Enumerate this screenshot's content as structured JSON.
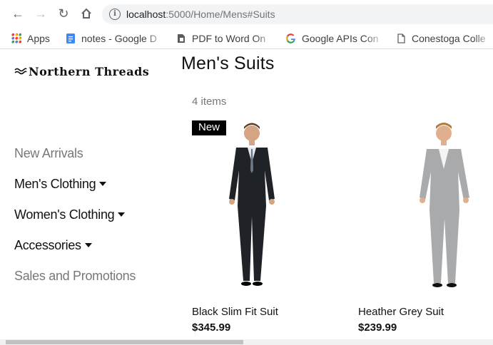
{
  "browser": {
    "url_host": "localhost",
    "url_rest": ":5000/Home/Mens#Suits",
    "bookmarks": [
      {
        "label": "Apps",
        "icon": "apps-grid-icon"
      },
      {
        "label": "notes - Google D",
        "icon": "google-docs-icon"
      },
      {
        "label": "PDF to Word On",
        "icon": "pdf-icon"
      },
      {
        "label": "Google APIs Con",
        "icon": "google-icon"
      },
      {
        "label": "Conestoga Colle",
        "icon": "page-icon"
      }
    ]
  },
  "brand": {
    "name": "Northern Threads"
  },
  "sidebar": {
    "items": [
      {
        "label": "New Arrivals",
        "dropdown": false
      },
      {
        "label": "Men's Clothing",
        "dropdown": true
      },
      {
        "label": "Women's Clothing",
        "dropdown": true
      },
      {
        "label": "Accessories",
        "dropdown": true
      },
      {
        "label": "Sales and Promotions",
        "dropdown": false
      }
    ]
  },
  "main": {
    "title": "Men's Suits",
    "count": "4 items",
    "products": [
      {
        "name": "Black Slim Fit Suit",
        "price": "$345.99",
        "badge": "New",
        "suit_color": "#1f2226"
      },
      {
        "name": "Heather Grey Suit",
        "price": "$239.99",
        "badge": "",
        "suit_color": "#a9aaac"
      }
    ]
  }
}
